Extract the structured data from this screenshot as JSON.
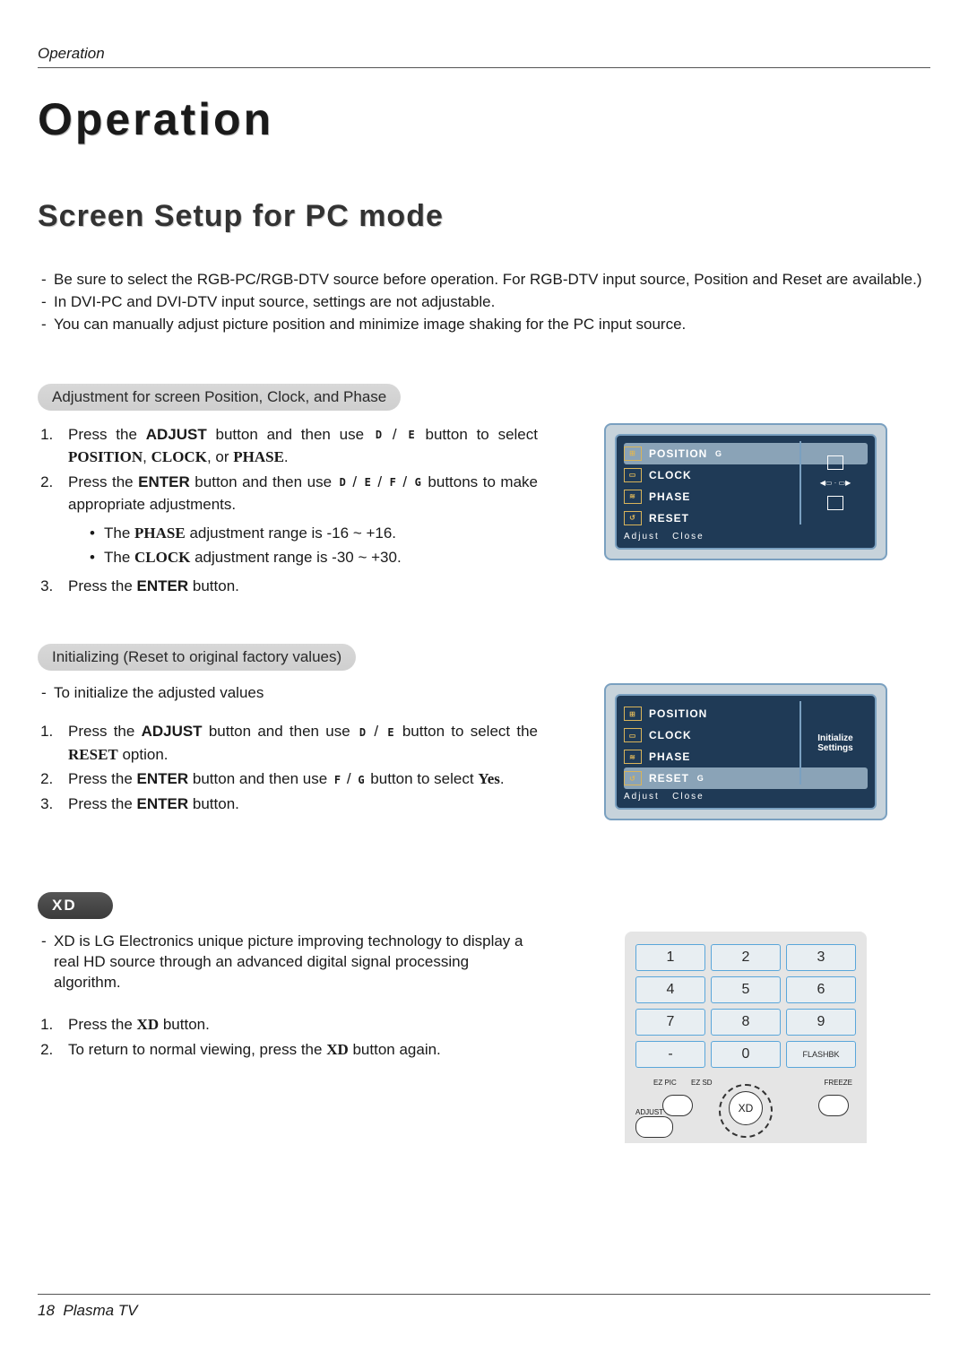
{
  "header": {
    "section": "Operation"
  },
  "titles": {
    "main": "Operation",
    "sub": "Screen Setup for PC mode"
  },
  "intro_bullets": [
    "Be sure to select the RGB-PC/RGB-DTV source before operation. For RGB-DTV input source, Position and Reset are available.)",
    "In DVI-PC and DVI-DTV input source, settings are not adjustable.",
    "You can manually adjust picture position and minimize image shaking for the PC input source."
  ],
  "section1": {
    "pill": "Adjustment for screen Position, Clock, and Phase",
    "step1_a": "Press the ",
    "step1_button": "ADJUST",
    "step1_b": " button and then use ",
    "step1_c": " button to select ",
    "opt_position": "POSITION",
    "opt_clock": "CLOCK",
    "opt_phase": "PHASE",
    "sep_comma": ", ",
    "sep_or": ", or ",
    "step1_end": ".",
    "step2_a": "Press the ",
    "step2_button": "ENTER",
    "step2_b": " button and then use ",
    "step2_c": " buttons to make appropriate adjustments.",
    "sub_phase": "The PHASE adjustment range is -16 ~ +16.",
    "sub_phase_a": "The ",
    "sub_phase_b": "PHASE",
    "sub_phase_c": " adjustment range is -16 ~ +16.",
    "sub_clock_a": "The ",
    "sub_clock_b": "CLOCK",
    "sub_clock_c": " adjustment range is -30 ~ +30.",
    "step3_a": "Press the ",
    "step3_button": "ENTER",
    "step3_b": " button."
  },
  "section2": {
    "pill": "Initializing (Reset to original factory values)",
    "lead": "To initialize the adjusted values",
    "step1_a": "Press the ",
    "step1_button": "ADJUST",
    "step1_b": " button and then use ",
    "step1_c": " button to select the ",
    "reset": "RESET",
    "step1_d": " option.",
    "step2_a": "Press the ",
    "step2_button": "ENTER",
    "step2_b": " button and then use ",
    "step2_c": " button to select ",
    "yes": "Yes",
    "step2_d": ".",
    "step3_a": "Press the ",
    "step3_button": "ENTER",
    "step3_b": " button."
  },
  "section3": {
    "pill": "XD",
    "lead": "XD is LG Electronics unique picture improving technology to display a real HD source through an advanced digital signal processing algorithm.",
    "step1_a": "Press the ",
    "step1_b": "XD",
    "step1_c": " button.",
    "step2_a": "To return to normal viewing, press the ",
    "step2_b": "XD",
    "step2_c": " button again."
  },
  "osd": {
    "items": [
      "POSITION",
      "CLOCK",
      "PHASE",
      "RESET"
    ],
    "g": "G",
    "adj": "Adjust",
    "close": "Close",
    "init": "Initialize Settings"
  },
  "remote": {
    "keys": [
      "1",
      "2",
      "3",
      "4",
      "5",
      "6",
      "7",
      "8",
      "9",
      "-",
      "0",
      "FLASHBK"
    ],
    "xd": "XD",
    "ezpic": "EZ PIC",
    "ezsd": "EZ SD",
    "freeze": "FREEZE",
    "adjust": "ADJUST"
  },
  "syms": {
    "d": "D",
    "e": "E",
    "f": "F",
    "g": "G"
  },
  "footer": {
    "page": "18",
    "label": "Plasma TV"
  }
}
